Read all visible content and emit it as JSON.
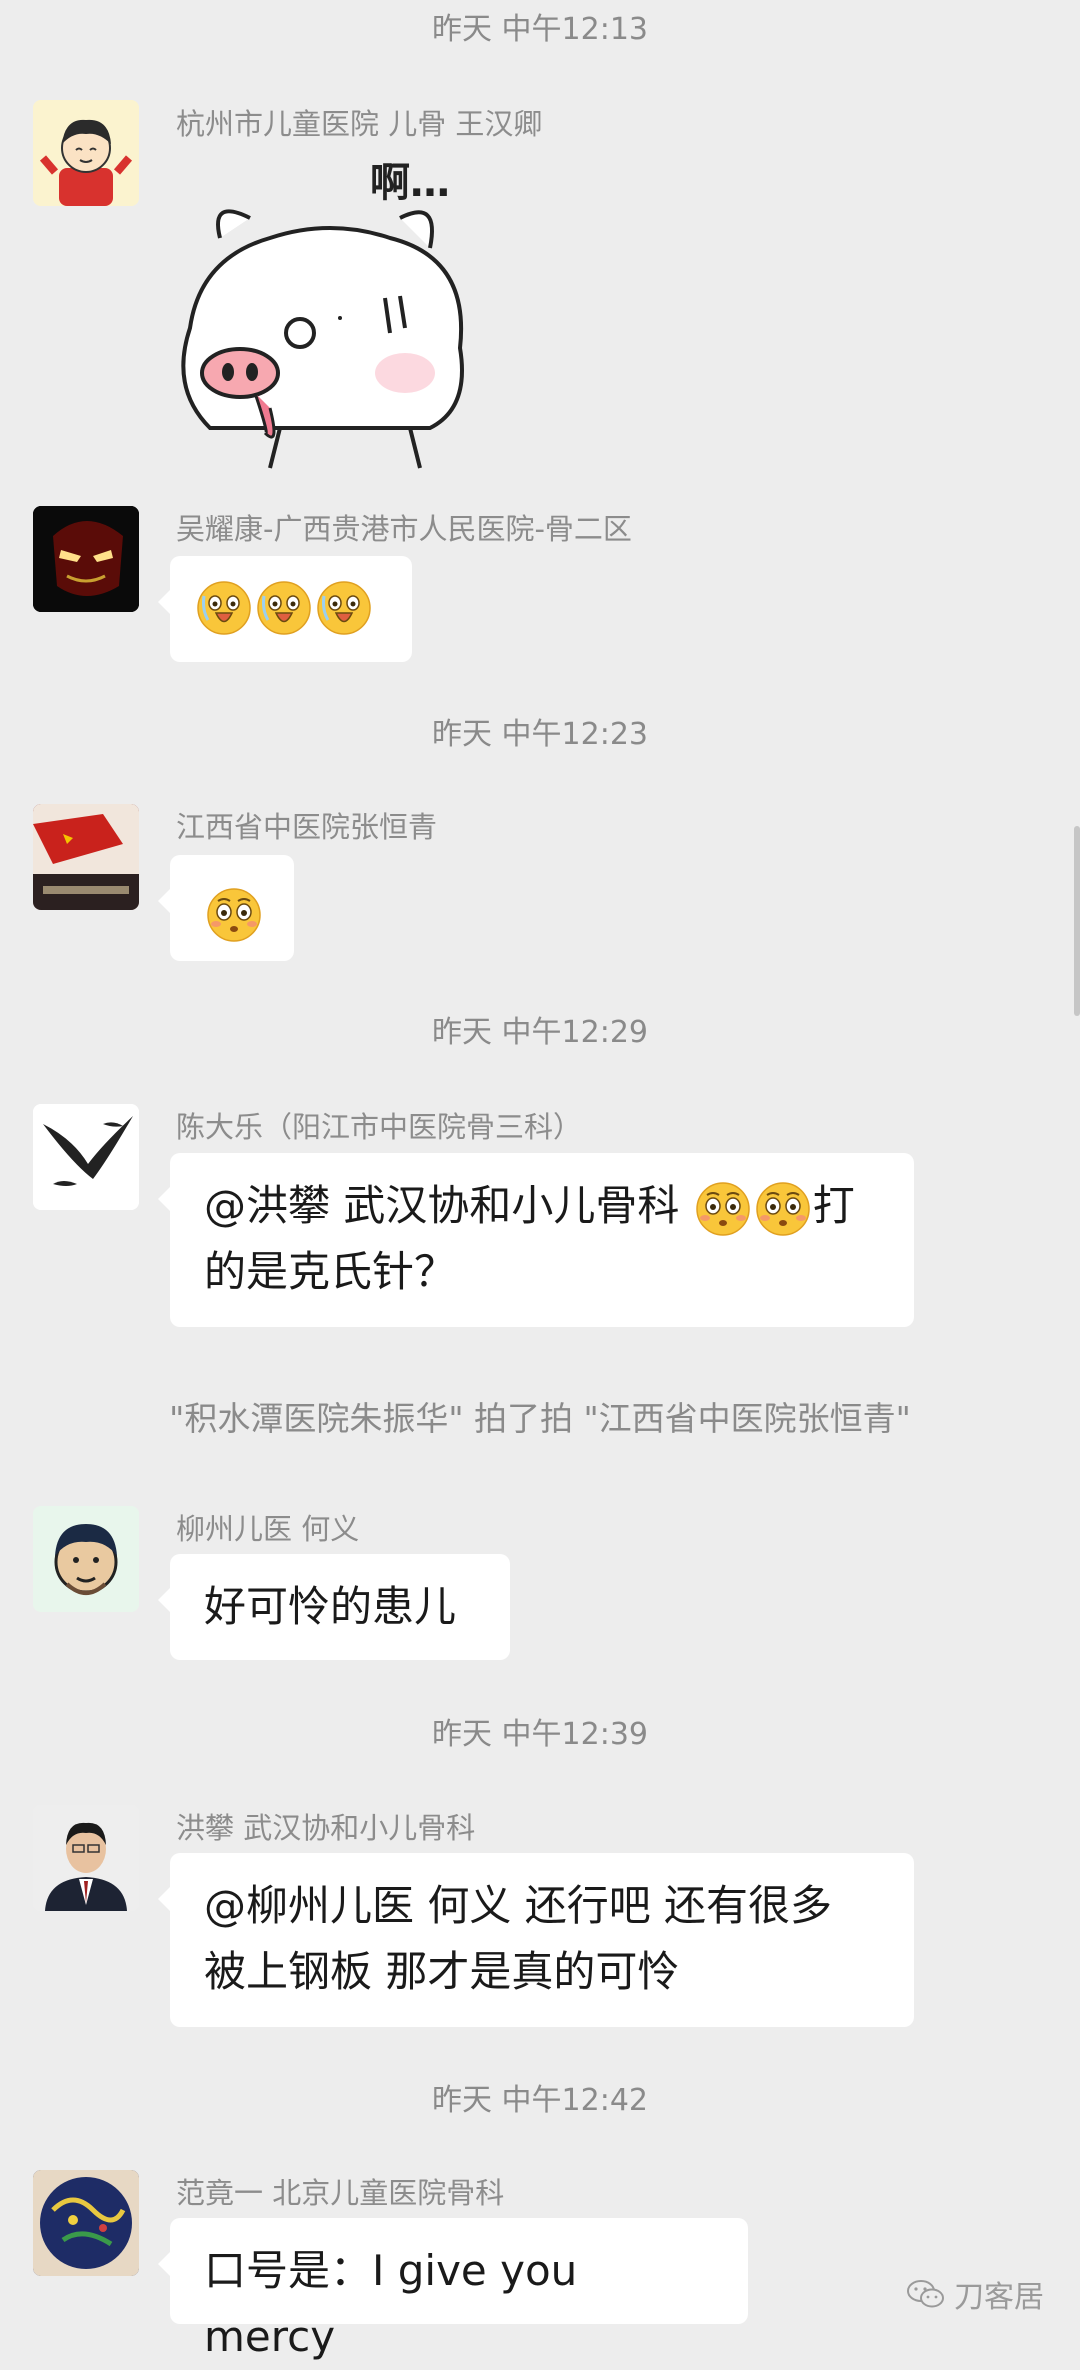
{
  "messages": {
    "ts1": "昨天 中午12:13",
    "m1": {
      "sender": "杭州市儿童医院 儿骨 王汉卿",
      "sticker_text": "啊…"
    },
    "m2": {
      "sender": "吴耀康-广西贵港市人民医院-骨二区"
    },
    "ts2": "昨天 中午12:23",
    "m3": {
      "sender": "江西省中医院张恒青"
    },
    "ts3": "昨天 中午12:29",
    "m4": {
      "sender": "陈大乐（阳江市中医院骨三科）",
      "line1a": "@洪攀 武汉协和小儿骨科 ",
      "line1b": "打",
      "line2": "的是克氏针？"
    },
    "sys1": "\"积水潭医院朱振华\" 拍了拍 \"江西省中医院张恒青\"",
    "m5": {
      "sender": "柳州儿医 何义",
      "text": "好可怜的患儿"
    },
    "ts4": "昨天 中午12:39",
    "m6": {
      "sender": "洪攀 武汉协和小儿骨科",
      "line1": "@柳州儿医 何义  还行吧 还有很多",
      "line2": "被上钢板 那才是真的可怜"
    },
    "ts5": "昨天 中午12:42",
    "m7": {
      "sender": "范竟一 北京儿童医院骨科",
      "text": "口号是：I give you mercy"
    }
  },
  "watermark": "刀客居",
  "icons": {
    "emoji_m2": "grimacing-emoji",
    "emoji_m3": "flushed-emoji",
    "emoji_m4": "flushed-emoji",
    "watermark": "wechat-icon"
  }
}
